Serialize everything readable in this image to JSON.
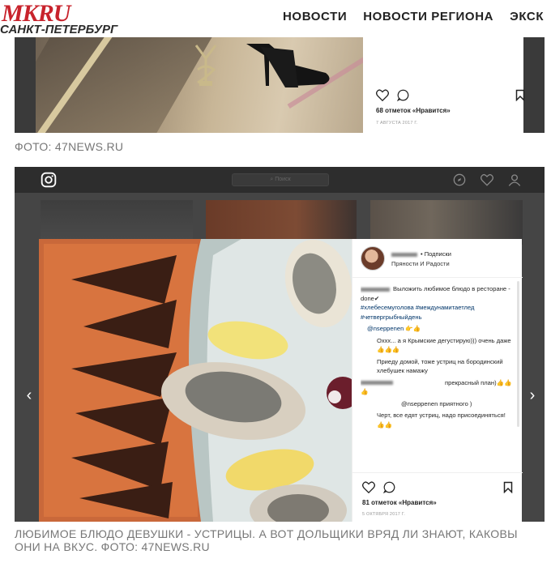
{
  "site": {
    "logo_main": "MK",
    "logo_ru": "RU",
    "logo_sub": "САНКТ-ПЕТЕРБУРГ",
    "nav": [
      "НОВОСТИ",
      "НОВОСТИ РЕГИОНА",
      "ЭКСК"
    ]
  },
  "photo1": {
    "likes": "68 отметок «Нравится»",
    "date": "7 АВГУСТА 2017 Г.",
    "caption": "ФОТО: 47NEWS.RU"
  },
  "photo2": {
    "search_placeholder": "Поиск",
    "post": {
      "follow": "• Подписки",
      "location": "Пряности И Радости",
      "caption_text": "Выложить любимое блюдо в ресторане - done✔",
      "hashtags": "#хлебесемуголова #междунамитаетлед #четвергрыбныйдень",
      "comment1_user": "@nseppenen",
      "comment1_emoji": "👉👍",
      "comment2": "Оххх... а я Крымские дегустирую))) очень даже👍👍👍",
      "comment3": "Приеду домой, тоже устриц на бородинский хлебушек намажу",
      "comment4_text": "прекрасный план)👍👍👍",
      "comment5": "@nseppenen приятного )",
      "comment6": "Черт, все едят устриц, надо присоединяться!",
      "comment6_emoji": "👍👍",
      "likes": "81 отметок «Нравится»",
      "date": "5 ОКТЯБРЯ 2017 Г."
    },
    "caption": "ЛЮБИМОЕ БЛЮДО ДЕВУШКИ - УСТРИЦЫ. А ВОТ ДОЛЬЩИКИ ВРЯД ЛИ ЗНАЮТ, КАКОВЫ ОНИ НА ВКУС. ФОТО: 47NEWS.RU"
  }
}
